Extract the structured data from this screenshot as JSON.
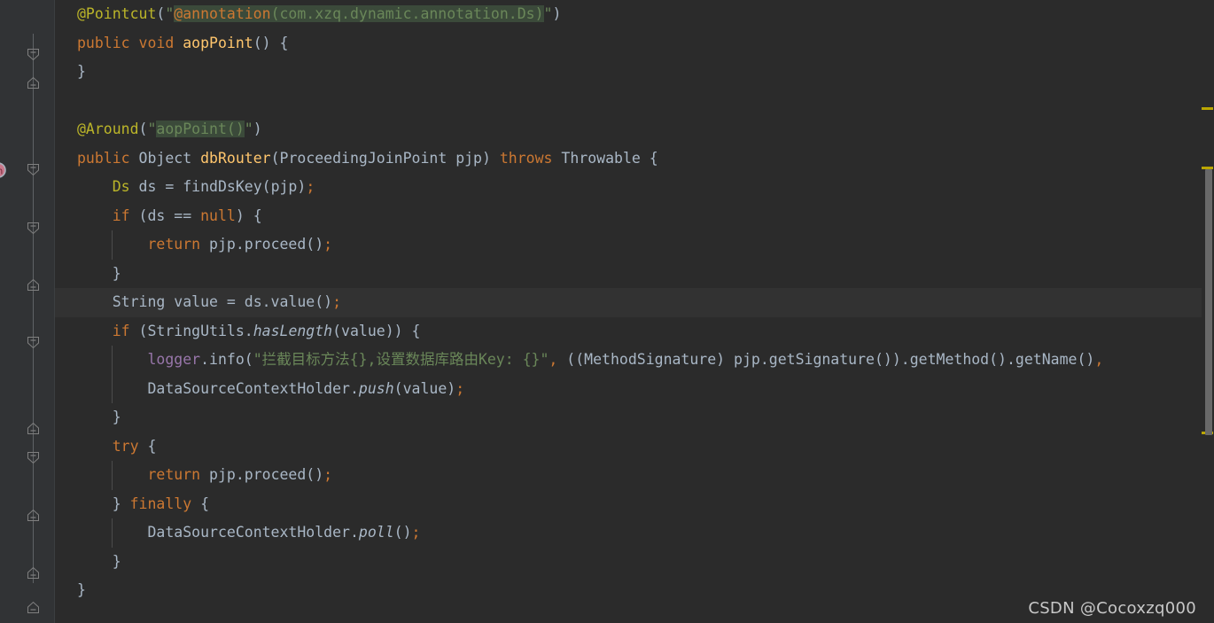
{
  "editor": {
    "background_color": "#2b2b2b",
    "gutter_color": "#313335",
    "current_line_color": "#323232",
    "selection_color": "#3b4a3a",
    "default_text_color": "#a9b7c6",
    "keyword_color": "#cc7832",
    "annotation_color": "#bbb529",
    "string_color": "#6a8759",
    "method_color": "#ffc66d",
    "field_color": "#9876aa",
    "marker_color": "#bba600"
  },
  "gutter": {
    "badge_icon": "method-override-marker-icon",
    "fold_icon_collapse": "fold-collapse-icon",
    "fold_icon_end": "fold-end-icon"
  },
  "scrollbar": {
    "thumb_name": "vertical-scrollbar-thumb",
    "marker_name": "warning-marker-stripe"
  },
  "watermark": {
    "text": "CSDN @Cocoxzq000"
  },
  "code": {
    "lines": [
      {
        "id": "line-pointcut",
        "tokens": [
          {
            "t": "@Pointcut",
            "c": "ann"
          },
          {
            "t": "(",
            "c": "pln"
          },
          {
            "t": "\"",
            "c": "str"
          },
          {
            "t": "@annotation",
            "c": "annorange sel"
          },
          {
            "t": "(com.xzq.dynamic.annotation.Ds)",
            "c": "str sel"
          },
          {
            "t": "\"",
            "c": "str"
          },
          {
            "t": ")",
            "c": "pln"
          }
        ]
      },
      {
        "id": "line-aoppoint-decl",
        "tokens": [
          {
            "t": "public",
            "c": "kw"
          },
          {
            "t": " ",
            "c": "pln"
          },
          {
            "t": "void",
            "c": "kw"
          },
          {
            "t": " ",
            "c": "pln"
          },
          {
            "t": "aopPoint",
            "c": "mth"
          },
          {
            "t": "() {",
            "c": "pln"
          }
        ]
      },
      {
        "id": "line-aoppoint-close",
        "tokens": [
          {
            "t": "}",
            "c": "pln"
          }
        ]
      },
      {
        "id": "line-blank-1",
        "tokens": []
      },
      {
        "id": "line-around",
        "tokens": [
          {
            "t": "@Around",
            "c": "ann"
          },
          {
            "t": "(",
            "c": "pln"
          },
          {
            "t": "\"",
            "c": "str"
          },
          {
            "t": "aopPoint()",
            "c": "str sel"
          },
          {
            "t": "\"",
            "c": "str"
          },
          {
            "t": ")",
            "c": "pln"
          }
        ]
      },
      {
        "id": "line-dbrouter-decl",
        "tokens": [
          {
            "t": "public",
            "c": "kw"
          },
          {
            "t": " Object ",
            "c": "pln"
          },
          {
            "t": "dbRouter",
            "c": "mth"
          },
          {
            "t": "(ProceedingJoinPoint pjp) ",
            "c": "pln"
          },
          {
            "t": "throws",
            "c": "kw"
          },
          {
            "t": " Throwable {",
            "c": "pln"
          }
        ]
      },
      {
        "id": "line-ds-findkey",
        "indent": 1,
        "tokens": [
          {
            "t": "Ds",
            "c": "ann"
          },
          {
            "t": " ds = findDsKey(pjp)",
            "c": "pln"
          },
          {
            "t": ";",
            "c": "smc"
          }
        ]
      },
      {
        "id": "line-if-null",
        "indent": 1,
        "tokens": [
          {
            "t": "if",
            "c": "kw"
          },
          {
            "t": " (ds == ",
            "c": "pln"
          },
          {
            "t": "null",
            "c": "kw"
          },
          {
            "t": ") {",
            "c": "pln"
          }
        ]
      },
      {
        "id": "line-return-proceed-1",
        "indent": 2,
        "tokens": [
          {
            "t": "return",
            "c": "kw"
          },
          {
            "t": " pjp.proceed()",
            "c": "pln"
          },
          {
            "t": ";",
            "c": "smc"
          }
        ]
      },
      {
        "id": "line-close-if-null",
        "indent": 1,
        "tokens": [
          {
            "t": "}",
            "c": "pln"
          }
        ]
      },
      {
        "id": "line-string-value",
        "indent": 1,
        "current": true,
        "tokens": [
          {
            "t": "String value = ds.value()",
            "c": "pln"
          },
          {
            "t": ";",
            "c": "smc"
          }
        ]
      },
      {
        "id": "line-if-haslength",
        "indent": 1,
        "tokens": [
          {
            "t": "if",
            "c": "kw"
          },
          {
            "t": " (StringUtils.",
            "c": "pln"
          },
          {
            "t": "hasLength",
            "c": "pln ital"
          },
          {
            "t": "(value)) {",
            "c": "pln"
          }
        ]
      },
      {
        "id": "line-logger-info",
        "indent": 2,
        "tokens": [
          {
            "t": "logger",
            "c": "fld"
          },
          {
            "t": ".info(",
            "c": "pln"
          },
          {
            "t": "\"拦截目标方法{},设置数据库路由Key: {}\"",
            "c": "str"
          },
          {
            "t": ",",
            "c": "smc"
          },
          {
            "t": " ((MethodSignature) pjp.getSignature()).getMethod().getName()",
            "c": "pln"
          },
          {
            "t": ",",
            "c": "smc"
          }
        ]
      },
      {
        "id": "line-push-value",
        "indent": 2,
        "tokens": [
          {
            "t": "DataSourceContextHolder.",
            "c": "pln"
          },
          {
            "t": "push",
            "c": "pln ital"
          },
          {
            "t": "(value)",
            "c": "pln"
          },
          {
            "t": ";",
            "c": "smc"
          }
        ]
      },
      {
        "id": "line-close-if-haslength",
        "indent": 1,
        "tokens": [
          {
            "t": "}",
            "c": "pln"
          }
        ]
      },
      {
        "id": "line-try",
        "indent": 1,
        "tokens": [
          {
            "t": "try",
            "c": "kw"
          },
          {
            "t": " {",
            "c": "pln"
          }
        ]
      },
      {
        "id": "line-return-proceed-2",
        "indent": 2,
        "tokens": [
          {
            "t": "return",
            "c": "kw"
          },
          {
            "t": " pjp.proceed()",
            "c": "pln"
          },
          {
            "t": ";",
            "c": "smc"
          }
        ]
      },
      {
        "id": "line-finally",
        "indent": 1,
        "tokens": [
          {
            "t": "} ",
            "c": "pln"
          },
          {
            "t": "finally",
            "c": "kw"
          },
          {
            "t": " {",
            "c": "pln"
          }
        ]
      },
      {
        "id": "line-poll",
        "indent": 2,
        "tokens": [
          {
            "t": "DataSourceContextHolder.",
            "c": "pln"
          },
          {
            "t": "poll",
            "c": "pln ital"
          },
          {
            "t": "()",
            "c": "pln"
          },
          {
            "t": ";",
            "c": "smc"
          }
        ]
      },
      {
        "id": "line-close-try",
        "indent": 1,
        "tokens": [
          {
            "t": "}",
            "c": "pln"
          }
        ]
      },
      {
        "id": "line-close-method",
        "tokens": [
          {
            "t": "}",
            "c": "pln"
          }
        ]
      }
    ]
  }
}
